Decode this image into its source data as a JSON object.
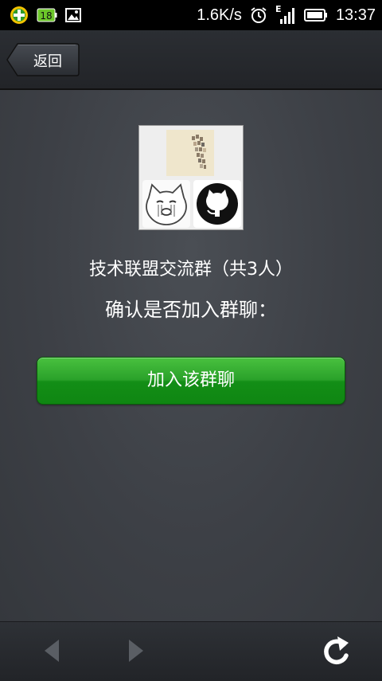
{
  "status_bar": {
    "net_speed": "1.6K/s",
    "network_type": "E",
    "time": "13:37",
    "icons": [
      "app-plus-icon",
      "battery-saver-icon",
      "image-icon",
      "alarm-icon",
      "signal-icon",
      "battery-icon"
    ],
    "battery_saver_number": "18"
  },
  "title_bar": {
    "back_label": "返回"
  },
  "group": {
    "name": "技术联盟交流群（共3人）",
    "prompt": "确认是否加入群聊：",
    "member_count": 3,
    "avatars": [
      "collage-avatar",
      "crying-cat-avatar",
      "github-octocat-avatar"
    ]
  },
  "actions": {
    "join_label": "加入该群聊"
  },
  "toolbar": {
    "icons": [
      "back-arrow-icon",
      "forward-arrow-icon",
      "refresh-icon"
    ]
  },
  "colors": {
    "join_button": "#2aa12a",
    "background": "#3d4046"
  }
}
